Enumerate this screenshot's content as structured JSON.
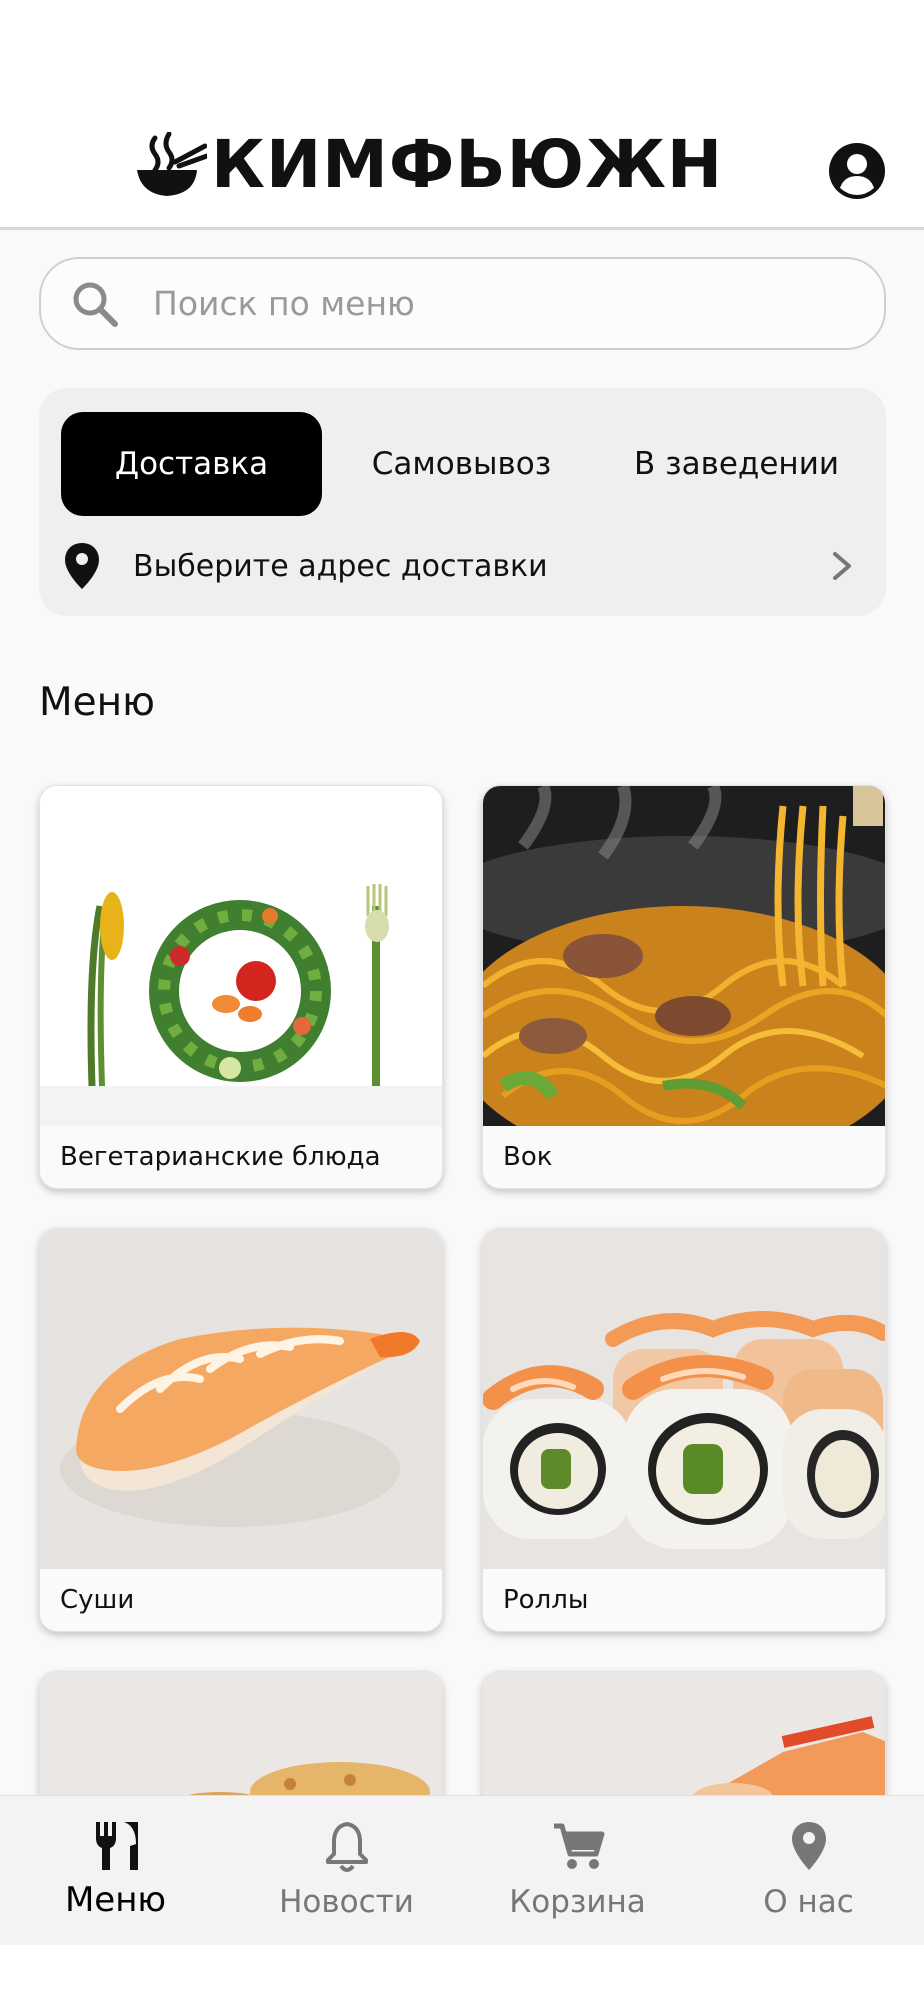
{
  "header": {
    "logo_text": "КИМФЬЮЖН",
    "logo_icon": "bowl-steam-icon",
    "profile_icon": "account-circle-icon"
  },
  "search": {
    "placeholder": "Поиск по меню",
    "icon": "search-icon"
  },
  "delivery": {
    "tabs": [
      {
        "label": "Доставка",
        "active": true
      },
      {
        "label": "Самовывоз",
        "active": false
      },
      {
        "label": "В заведении",
        "active": false
      }
    ],
    "address_label": "Выберите адрес доставки"
  },
  "menu": {
    "title": "Меню",
    "categories": [
      {
        "label": "Вегетарианские блюда",
        "image": "vegetarian-plate"
      },
      {
        "label": "Вок",
        "image": "wok-noodles"
      },
      {
        "label": "Суши",
        "image": "shrimp-sushi"
      },
      {
        "label": "Роллы",
        "image": "shrimp-rolls"
      },
      {
        "label": "",
        "image": "partial-dish-1"
      },
      {
        "label": "",
        "image": "partial-dish-2"
      }
    ]
  },
  "bottom_nav": {
    "items": [
      {
        "label": "Меню",
        "icon": "fork-knife-icon",
        "active": true
      },
      {
        "label": "Новости",
        "icon": "bell-icon",
        "active": false
      },
      {
        "label": "Корзина",
        "icon": "cart-icon",
        "active": false
      },
      {
        "label": "О нас",
        "icon": "location-pin-icon",
        "active": false
      }
    ]
  },
  "colors": {
    "accent": "#000000",
    "background": "#f9f9f9",
    "card": "#efefef",
    "inactive_nav": "#777777"
  }
}
